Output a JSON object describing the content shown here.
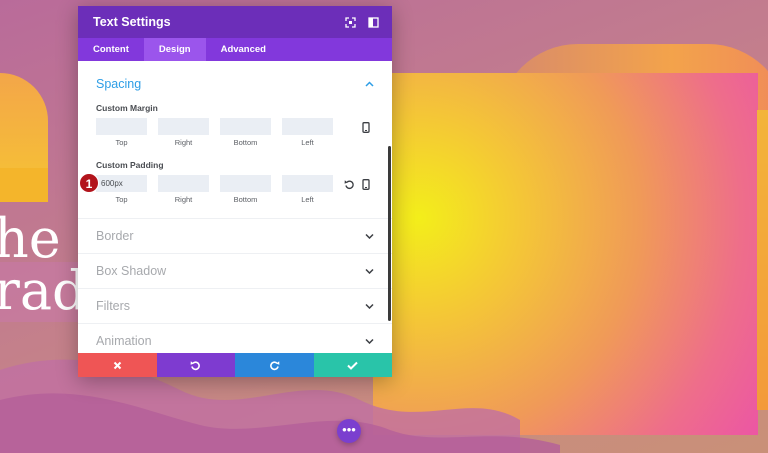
{
  "modal": {
    "title": "Text Settings",
    "tabs": [
      {
        "label": "Content",
        "active": false
      },
      {
        "label": "Design",
        "active": true
      },
      {
        "label": "Advanced",
        "active": false
      }
    ]
  },
  "spacing": {
    "title": "Spacing",
    "margin": {
      "label": "Custom Margin",
      "fields": [
        {
          "label": "Top",
          "value": ""
        },
        {
          "label": "Right",
          "value": ""
        },
        {
          "label": "Bottom",
          "value": ""
        },
        {
          "label": "Left",
          "value": ""
        }
      ]
    },
    "padding": {
      "label": "Custom Padding",
      "fields": [
        {
          "label": "Top",
          "value": "600px"
        },
        {
          "label": "Right",
          "value": ""
        },
        {
          "label": "Bottom",
          "value": ""
        },
        {
          "label": "Left",
          "value": ""
        }
      ]
    }
  },
  "sections": [
    "Border",
    "Box Shadow",
    "Filters",
    "Animation"
  ],
  "step_badge": "1",
  "background": {
    "line1": "he t",
    "line2": "radi"
  },
  "icons": {
    "header": [
      "fullscreen-icon",
      "sidebar-icon"
    ],
    "responsive": "mobile-icon",
    "reset": "reset-icon",
    "footer": [
      "close-icon",
      "undo-icon",
      "redo-icon",
      "check-icon"
    ],
    "fab": "more-dots-icon"
  },
  "colors": {
    "header": "#6c2eb9",
    "tabs": "#8238dc",
    "section_open": "#2e9ee6",
    "cancel": "#ef5555",
    "undo": "#7e3bd0",
    "redo": "#2b87da",
    "save": "#29c4a9",
    "badge": "#b2141c"
  }
}
